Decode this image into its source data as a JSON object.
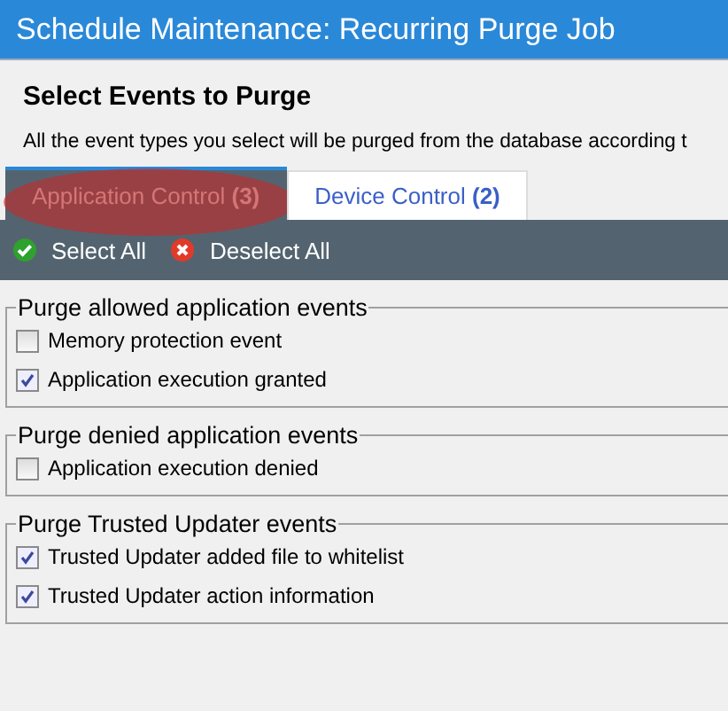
{
  "window": {
    "title": "Schedule Maintenance: Recurring Purge Job"
  },
  "heading": "Select Events to Purge",
  "description": "All the event types you select will be purged from the database according t",
  "tabs": [
    {
      "label": "Application Control",
      "count": "(3)",
      "selected": true,
      "highlighted": true
    },
    {
      "label": "Device Control",
      "count": "(2)",
      "selected": false,
      "highlighted": false
    }
  ],
  "toolbar": [
    {
      "kind": "select",
      "label": "Select All"
    },
    {
      "kind": "deselect",
      "label": "Deselect All"
    }
  ],
  "groups": [
    {
      "title": "Purge allowed application events",
      "items": [
        {
          "label": "Memory protection event",
          "checked": false
        },
        {
          "label": "Application execution granted",
          "checked": true
        }
      ]
    },
    {
      "title": "Purge denied application events",
      "items": [
        {
          "label": "Application execution denied",
          "checked": false
        }
      ]
    },
    {
      "title": "Purge Trusted Updater events",
      "items": [
        {
          "label": "Trusted Updater added file to whitelist",
          "checked": true
        },
        {
          "label": "Trusted Updater action information",
          "checked": true
        }
      ]
    }
  ]
}
